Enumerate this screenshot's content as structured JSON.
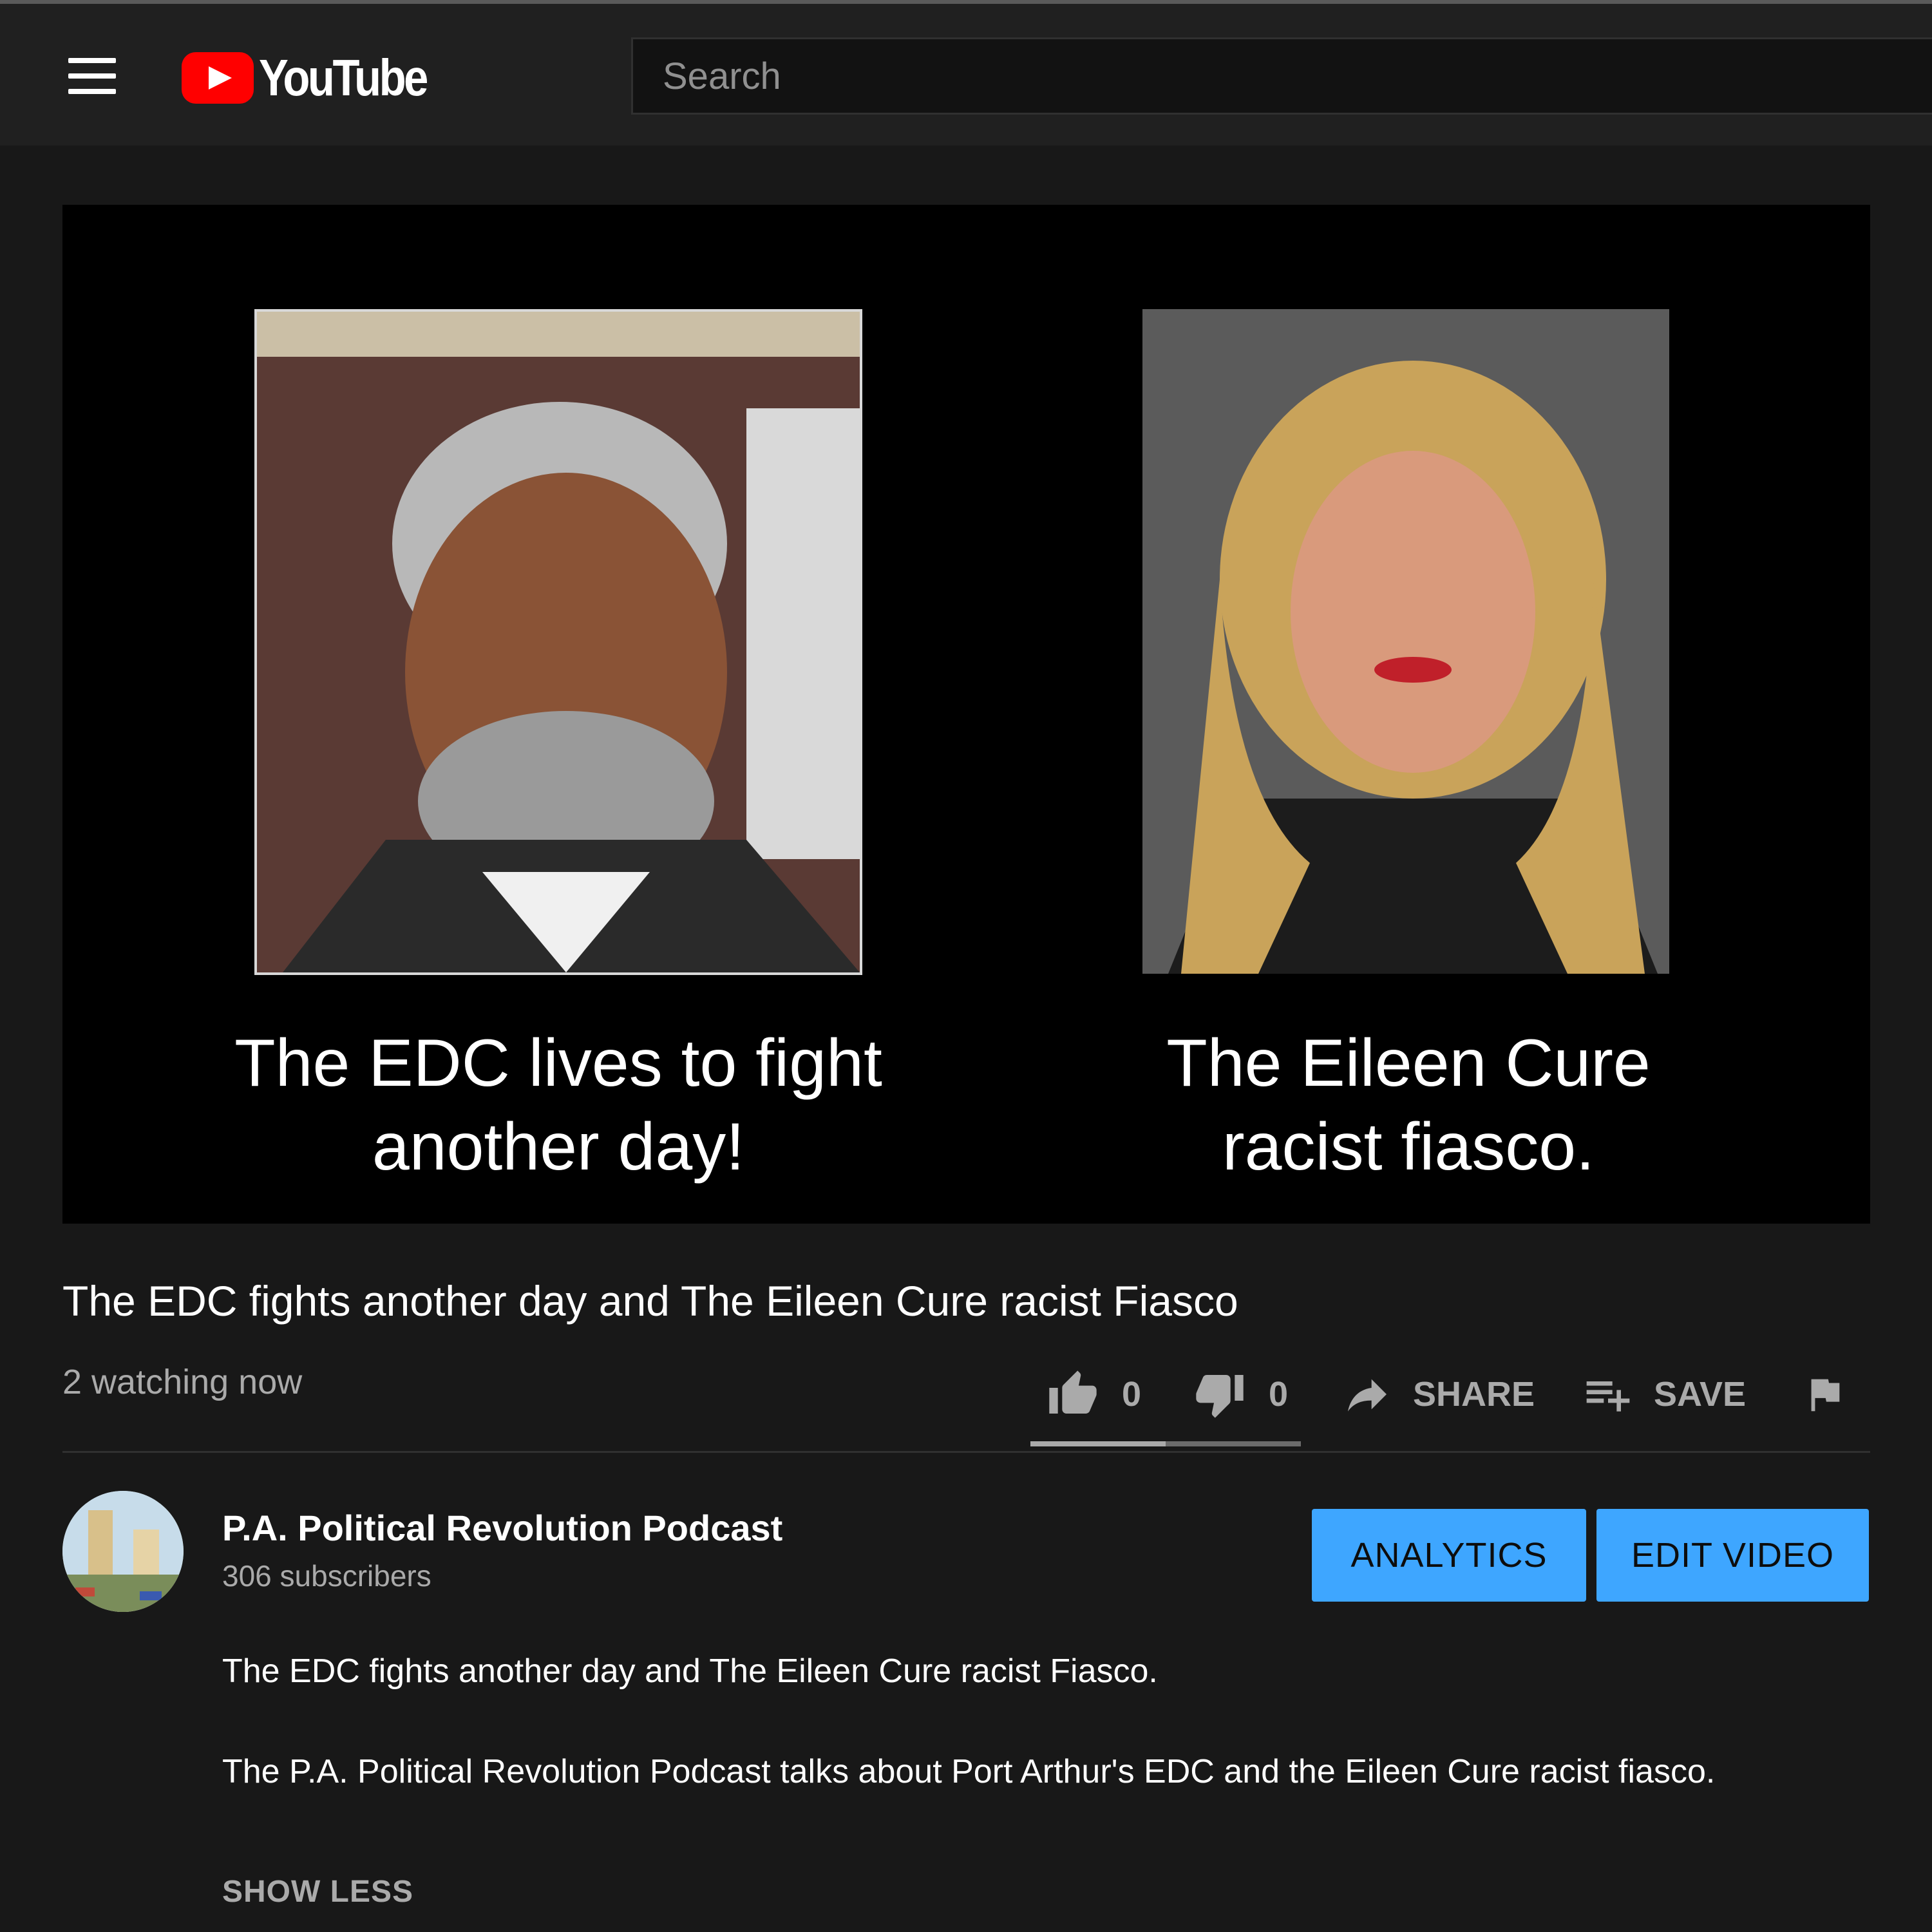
{
  "header": {
    "logo_text": "YouTube",
    "search_placeholder": "Search"
  },
  "player": {
    "caption_left": "The EDC lives to fight another day!",
    "caption_right": "The Eileen Cure racist fiasco."
  },
  "video": {
    "title": "The EDC fights another day and The Eileen Cure racist Fiasco",
    "watching": "2 watching now",
    "likes": "0",
    "dislikes": "0",
    "like_ratio": 0.5,
    "share_label": "SHARE",
    "save_label": "SAVE"
  },
  "channel": {
    "name": "P.A. Political Revolution Podcast",
    "subscribers": "306 subscribers",
    "analytics_label": "ANALYTICS",
    "edit_label": "EDIT VIDEO"
  },
  "description": {
    "line1": "The EDC fights another day and The Eileen Cure racist Fiasco.",
    "line2": "The P.A. Political Revolution Podcast talks about Port Arthur's EDC and the Eileen Cure racist fiasco.",
    "show_less": "SHOW LESS"
  },
  "colors": {
    "background": "#181818",
    "masthead": "#202020",
    "accent_button": "#3ea6ff",
    "logo_red": "#ff0000"
  },
  "icons": [
    "menu-icon",
    "youtube-logo-icon",
    "thumbs-up-icon",
    "thumbs-down-icon",
    "share-icon",
    "save-playlist-icon",
    "flag-icon"
  ]
}
